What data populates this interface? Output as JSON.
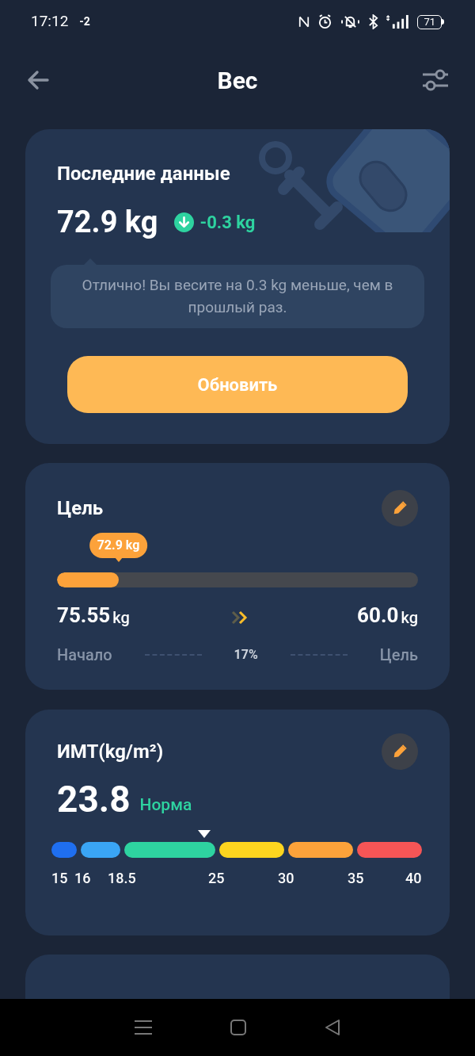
{
  "status_bar": {
    "time": "17:12",
    "extra": "-2",
    "battery": "71"
  },
  "header": {
    "title": "Вес"
  },
  "latest": {
    "title": "Последние данные",
    "value": "72.9 kg",
    "change": "-0.3 kg",
    "message": "Отлично! Вы весите на 0.3 kg меньше, чем в прошлый раз.",
    "button": "Обновить"
  },
  "goal": {
    "title": "Цель",
    "bubble": "72.9 kg",
    "level": 0.17,
    "start_value": "75.55",
    "start_unit": "kg",
    "target_value": "60.0",
    "target_unit": "kg",
    "start_label": "Начало",
    "percent": "17%",
    "target_label": "Цель"
  },
  "bmi": {
    "title": "ИМТ(kg/m²)",
    "value": "23.8",
    "category": "Норма",
    "segments": [
      {
        "color": "#1f6ff0"
      },
      {
        "color": "#3aa5f5"
      },
      {
        "color": "#2ed3a0"
      },
      {
        "color": "#fdd51f"
      },
      {
        "color": "#fca23a"
      },
      {
        "color": "#f65556"
      }
    ],
    "ticks": [
      "15",
      "16",
      "18.5",
      "25",
      "30",
      "35",
      "40"
    ]
  }
}
